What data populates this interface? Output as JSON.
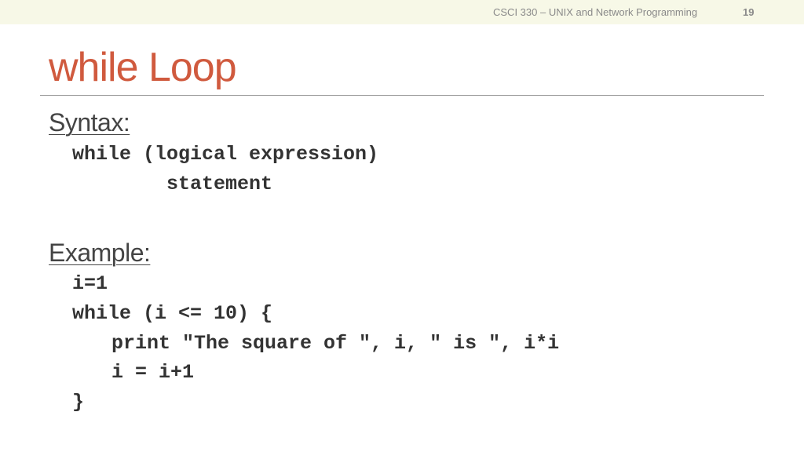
{
  "header": {
    "course_title": "CSCI 330 – UNIX and Network Programming",
    "slide_number": "19"
  },
  "slide": {
    "title": "while Loop",
    "syntax": {
      "label": "Syntax:",
      "lines": [
        "while (logical expression)",
        "statement"
      ]
    },
    "example": {
      "label": "Example:",
      "lines": [
        "i=1",
        "while (i <= 10) {",
        "print \"The square of \", i, \" is \", i*i",
        "i = i+1",
        "}"
      ]
    }
  },
  "colors": {
    "title": "#d05a3e",
    "header_band": "#f7f8e7",
    "body_text": "#444444"
  }
}
